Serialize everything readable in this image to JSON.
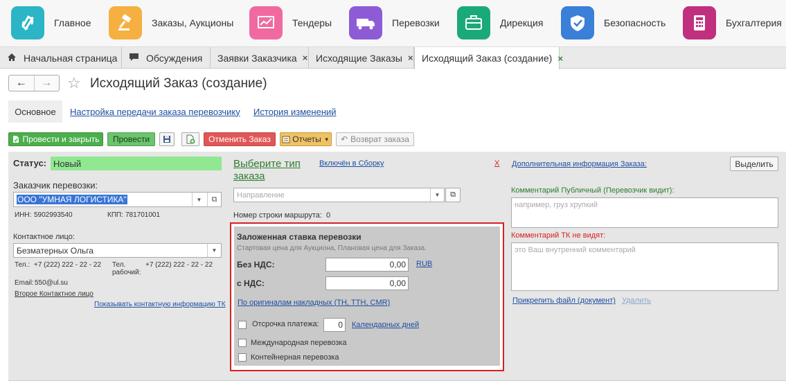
{
  "modules": [
    {
      "label": "Главное",
      "icon": "logo-icon",
      "color": "#2bb5c7"
    },
    {
      "label": "Заказы, Аукционы",
      "icon": "gavel-icon",
      "color": "#f5b041"
    },
    {
      "label": "Тендеры",
      "icon": "chart-icon",
      "color": "#f06aa0"
    },
    {
      "label": "Перевозки",
      "icon": "truck-icon",
      "color": "#8e5bd6"
    },
    {
      "label": "Дирекция",
      "icon": "briefcase-icon",
      "color": "#1aaa7a"
    },
    {
      "label": "Безопасность",
      "icon": "shield-icon",
      "color": "#3a7fd8"
    },
    {
      "label": "Бухгалтерия",
      "icon": "calculator-icon",
      "color": "#c0307f"
    }
  ],
  "tabs": [
    {
      "label": "Начальная страница"
    },
    {
      "label": "Обсуждения"
    },
    {
      "label": "Заявки Заказчика",
      "close": "×"
    },
    {
      "label": "Исходящие Заказы",
      "close": "×"
    },
    {
      "label": "Исходящий Заказ (создание)",
      "close": "×"
    }
  ],
  "header": {
    "title": "Исходящий Заказ (создание)"
  },
  "subtabs": {
    "main": "Основное",
    "carrier_settings": "Настройка передачи заказа перевозчику",
    "history": "История изменений"
  },
  "toolbar": {
    "post_close": "Провести и закрыть",
    "post": "Провести",
    "cancel_order": "Отменить Заказ",
    "reports": "Отчеты",
    "return_order": "Возврат заказа"
  },
  "left": {
    "status_label": "Статус:",
    "status_value": "Новый",
    "customer_label": "Заказчик перевозки:",
    "customer_value": "ООО \"УМНАЯ ЛОГИСТИКА\"",
    "inn_label": "ИНН:",
    "inn_value": "5902993540",
    "kpp_label": "КПП:",
    "kpp_value": "781701001",
    "contact_label": "Контактное лицо:",
    "contact_value": "Безматерных Ольга",
    "phone_label": "Тел.:",
    "phone_value": "+7 (222) 222 - 22 - 22",
    "work_phone_label_1": "Тел.",
    "work_phone_label_2": "рабочий:",
    "work_phone_value": "+7 (222) 222 - 22 - 22",
    "email_label": "Email:",
    "email_value": "550@ul.su",
    "second_contact": "Второе Контактное лицо",
    "show_contact_tk": "Показывать контактную информацию ТК"
  },
  "middle": {
    "choose_type_1": "Выберите тип",
    "choose_type_2": "заказа",
    "included": "Включён в Сборку",
    "clear": "X",
    "direction_placeholder": "Направление",
    "route_row_label": "Номер строки маршрута:",
    "route_row_value": "0"
  },
  "rate": {
    "title": "Заложенная ставка перевозки",
    "subtitle": "Стартовая цена для Аукциона, Плановая цена для Заказа.",
    "no_vat_label": "Без НДС:",
    "no_vat_value": "0,00",
    "currency": "RUB",
    "vat_label": "с НДС:",
    "vat_value": "0,00",
    "originals": "По оригиналам накладных (ТН, ТТН, CMR)",
    "deferral_label": "Отсрочка платежа:",
    "deferral_value": "0",
    "calendar_days": "Календарных дней",
    "international": "Международная перевозка",
    "container": "Контейнерная перевозка"
  },
  "right": {
    "highlight": "Выделить",
    "additional_info": "Дополнительная информация Заказа:",
    "public_comment_label": "Комментарий Публичный (Перевозчик видит):",
    "public_comment_placeholder": "например, груз хрупкий",
    "tk_comment_label": "Комментарий ТК не видят:",
    "tk_comment_placeholder": "это Ваш внутренний комментарий",
    "attach_file": "Прикрепить файл (документ)",
    "delete": "Удалить"
  },
  "colors": {
    "accent_green": "#4cae4c",
    "link_blue": "#1d4fa0",
    "highlight_red": "#d91f1f"
  }
}
